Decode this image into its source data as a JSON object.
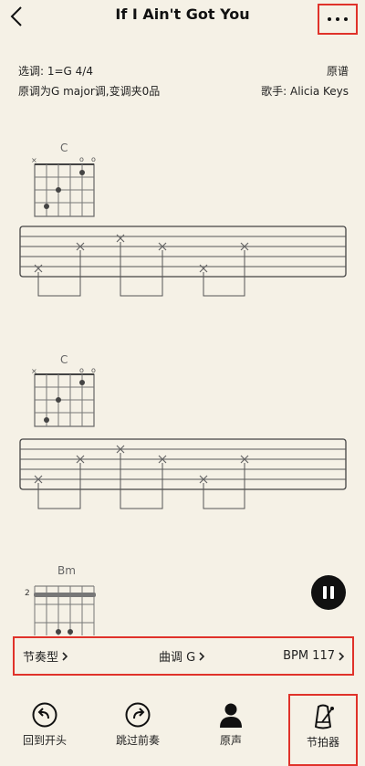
{
  "header": {
    "title": "If I Ain't Got You"
  },
  "info": {
    "key_line": "选调:  1=G 4/4",
    "original_key_line": "原调为G major调,变调夹0品",
    "sheet_type": "原谱",
    "singer_line": "歌手:  Alicia Keys"
  },
  "chords": [
    {
      "name": "C"
    },
    {
      "name": "C"
    },
    {
      "name": "Bm",
      "fret": "2"
    }
  ],
  "chord_marks": {
    "mute": "×",
    "open": "o"
  },
  "bottom_bar": {
    "rhythm_label": "节奏型",
    "key_label": "曲调 G",
    "bpm_label": "BPM 117"
  },
  "toolbar": {
    "items": [
      {
        "label": "回到开头",
        "icon": "rewind-to-start-icon"
      },
      {
        "label": "跳过前奏",
        "icon": "skip-intro-icon"
      },
      {
        "label": "原声",
        "icon": "person-icon"
      },
      {
        "label": "节拍器",
        "icon": "metronome-icon"
      }
    ]
  },
  "colors": {
    "background": "#f5f1e6",
    "highlight": "#e0322a",
    "ink": "#333333"
  }
}
